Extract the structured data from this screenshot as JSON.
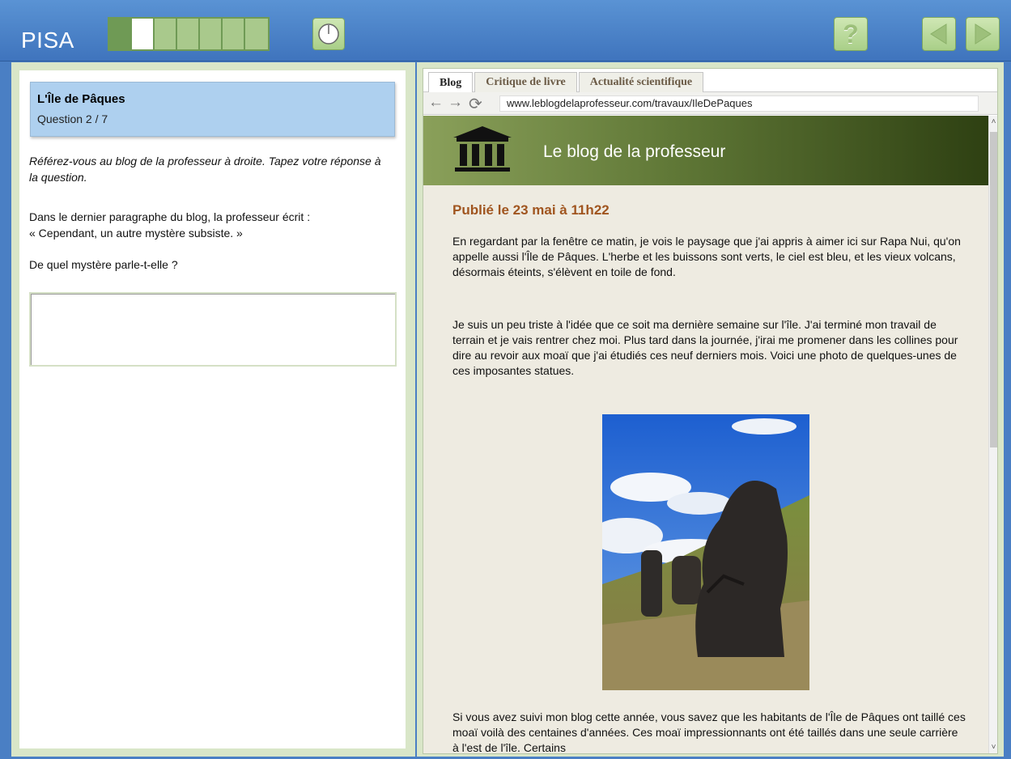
{
  "header": {
    "app_title": "PISA",
    "progress": {
      "total": 7,
      "current": 2
    },
    "icons": {
      "timer": "clock-icon",
      "help": "help-icon",
      "back": "back-arrow-icon",
      "next": "next-arrow-icon"
    },
    "help_label": "?"
  },
  "left": {
    "unit_title": "L'Île de Pâques",
    "question_number": "Question 2 / 7",
    "instruction": "Référez-vous au blog de la professeur à droite. Tapez votre réponse à la question.",
    "prompt_line1": "Dans le dernier paragraphe du blog, la professeur écrit :",
    "prompt_line2": "« Cependant, un autre mystère subsiste. »",
    "question": "De quel mystère parle-t-elle ?",
    "answer_value": ""
  },
  "browser": {
    "tabs": [
      {
        "label": "Blog",
        "active": true
      },
      {
        "label": "Critique de livre",
        "active": false
      },
      {
        "label": "Actualité scientifique",
        "active": false
      }
    ],
    "url": "www.leblogdelaprofesseur.com/travaux/IleDePaques",
    "blog_name": "Le blog de la professeur",
    "post_date": "Publié le 23 mai à 11h22",
    "para1": "En regardant par la fenêtre ce matin, je vois le paysage que j'ai appris à aimer ici sur Rapa Nui, qu'on appelle aussi l'Île de Pâques. L'herbe et les buissons sont verts, le ciel est bleu, et les vieux volcans, désormais éteints, s'élèvent en toile de fond.",
    "para2": "Je suis un peu triste à l'idée que ce soit ma dernière semaine sur l'île. J'ai terminé mon travail de terrain et je vais rentrer chez moi. Plus tard dans la journée, j'irai me promener dans les collines pour dire au revoir aux moaï que j'ai étudiés ces neuf derniers mois. Voici une photo de quelques-unes de ces imposantes statues.",
    "para3": "Si vous avez suivi mon blog cette année, vous savez que les habitants de l'Île de Pâques ont taillé ces moaï voilà des centaines d'années. Ces moaï impressionnants ont été taillés dans une seule carrière à l'est de l'île. Certains",
    "colors": {
      "date": "#a0551f",
      "banner_dark": "#2e4012",
      "banner_light": "#8aa05a",
      "page_bg": "#eeebe1"
    }
  }
}
